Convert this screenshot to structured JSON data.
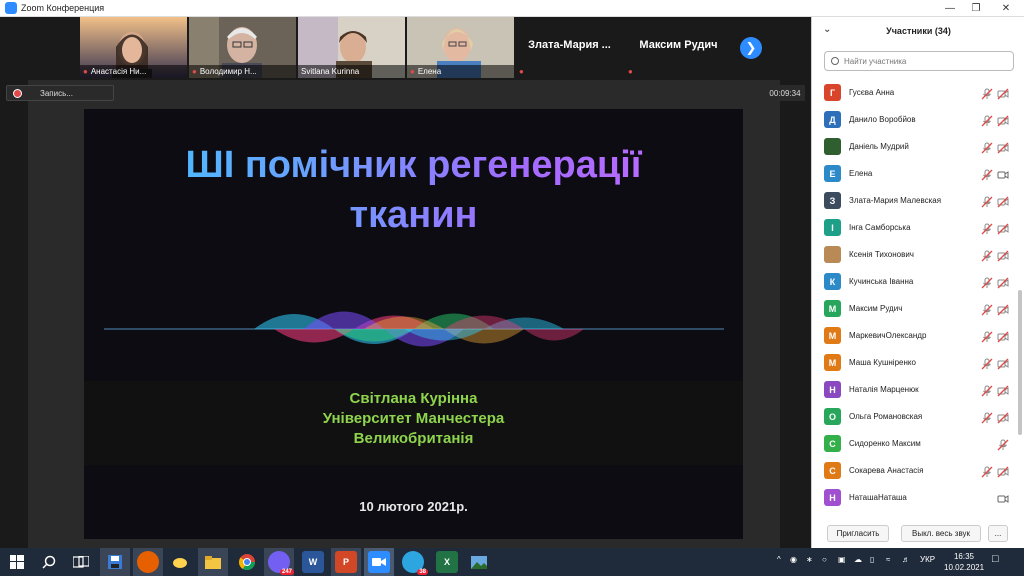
{
  "window": {
    "title": "Zoom Конференция"
  },
  "thumbnails": [
    {
      "name": "Анастасія Ни...",
      "muted": true
    },
    {
      "name": "Володимир Н...",
      "muted": true
    },
    {
      "name": "Svitlana Kurinna",
      "muted": false
    },
    {
      "name": "Елена",
      "muted": true
    },
    {
      "name": "Злата-Мария ...",
      "muted": true
    },
    {
      "name": "Максим Рудич",
      "muted": true
    }
  ],
  "recording": {
    "label": "Запись..."
  },
  "timer": {
    "value": "00:09:34"
  },
  "slide": {
    "title_line1": "ШІ помічник регенерації",
    "title_line2": "тканин",
    "speaker_name": "Світлана Курінна",
    "speaker_org": "Університет Манчестера",
    "speaker_country": "Великобританія",
    "date": "10 лютого 2021р."
  },
  "panel": {
    "title": "Участники (34)",
    "search_placeholder": "Найти участника",
    "participants": [
      {
        "initial": "Г",
        "name": "Гусєва Анна",
        "color": "#d9452b",
        "mic": "muted",
        "cam": "off"
      },
      {
        "initial": "Д",
        "name": "Данило Воробйов",
        "color": "#2d6fb8",
        "mic": "muted",
        "cam": "off"
      },
      {
        "initial": "",
        "name": "Даніель Мудрий",
        "color": "#2f5e2f",
        "mic": "muted",
        "cam": "off"
      },
      {
        "initial": "Е",
        "name": "Елена",
        "color": "#2d8ac9",
        "mic": "muted",
        "cam": "on"
      },
      {
        "initial": "З",
        "name": "Злата-Мария Малевская",
        "color": "#3c4b5e",
        "mic": "muted",
        "cam": "off"
      },
      {
        "initial": "І",
        "name": "Інга Самборська",
        "color": "#1ea088",
        "mic": "muted",
        "cam": "off"
      },
      {
        "initial": "",
        "name": "Ксенія Тихонович",
        "color": "#b98a55",
        "mic": "muted",
        "cam": "off"
      },
      {
        "initial": "К",
        "name": "Кучинська Іванна",
        "color": "#2d8ac9",
        "mic": "muted",
        "cam": "off"
      },
      {
        "initial": "М",
        "name": "Максим Рудич",
        "color": "#27a65c",
        "mic": "muted",
        "cam": "off"
      },
      {
        "initial": "М",
        "name": "МаркевичОлександр",
        "color": "#e07a16",
        "mic": "muted",
        "cam": "off"
      },
      {
        "initial": "М",
        "name": "Маша Кушніренко",
        "color": "#e07a16",
        "mic": "muted",
        "cam": "off"
      },
      {
        "initial": "Н",
        "name": "Наталія Марценюк",
        "color": "#8a49c0",
        "mic": "muted",
        "cam": "off"
      },
      {
        "initial": "О",
        "name": "Ольга Романовская",
        "color": "#27a65c",
        "mic": "muted",
        "cam": "off"
      },
      {
        "initial": "С",
        "name": "Сидоренко Максим",
        "color": "#33b04a",
        "mic": "muted",
        "cam": "none"
      },
      {
        "initial": "С",
        "name": "Сокарева Анастасія",
        "color": "#e07a16",
        "mic": "muted",
        "cam": "off"
      },
      {
        "initial": "Н",
        "name": "НаташаНаташа",
        "color": "#a04fd0",
        "mic": "none",
        "cam": "on"
      }
    ],
    "buttons": {
      "invite": "Пригласить",
      "mute_all": "Выкл. весь звук",
      "more": "..."
    }
  },
  "taskbar": {
    "language": "УКР",
    "time": "16:35",
    "date": "10.02.2021",
    "badges": {
      "viber": "247",
      "telegram": "38"
    },
    "word_label": "W",
    "ppt_label": "P",
    "excel_label": "X"
  }
}
